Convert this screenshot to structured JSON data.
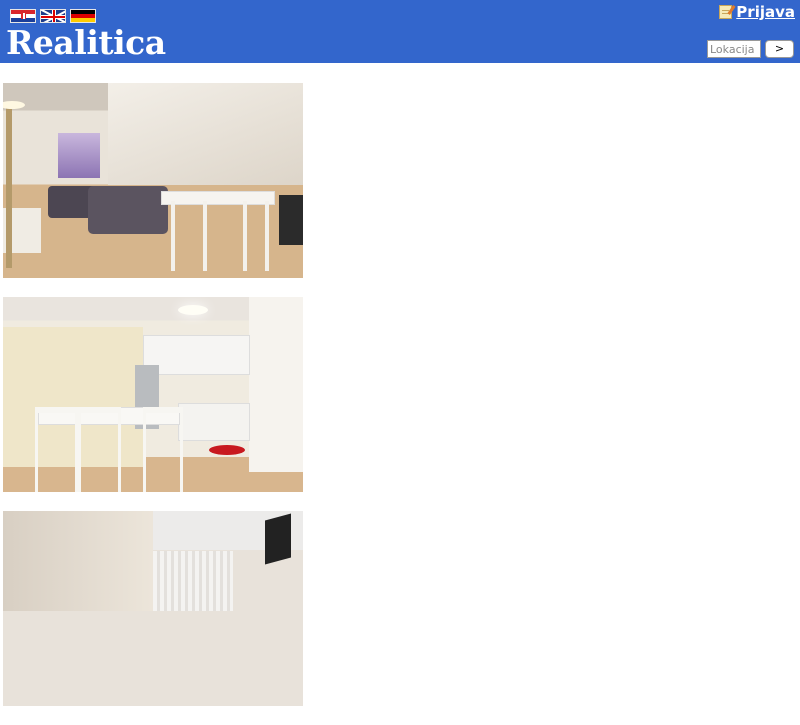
{
  "header": {
    "background_color": "#3366cc",
    "flags": [
      {
        "name": "croatian-flag-icon",
        "language": "hr"
      },
      {
        "name": "uk-flag-icon",
        "language": "en"
      },
      {
        "name": "german-flag-icon",
        "language": "de"
      }
    ],
    "logo": "Realitica",
    "login_label": "Prijava",
    "login_icon": "note-icon",
    "search": {
      "placeholder": "Lokacija i",
      "submit_label": ">"
    }
  },
  "photos": [
    {
      "alt": "living-room"
    },
    {
      "alt": "kitchen-dining"
    },
    {
      "alt": "bedroom"
    }
  ]
}
